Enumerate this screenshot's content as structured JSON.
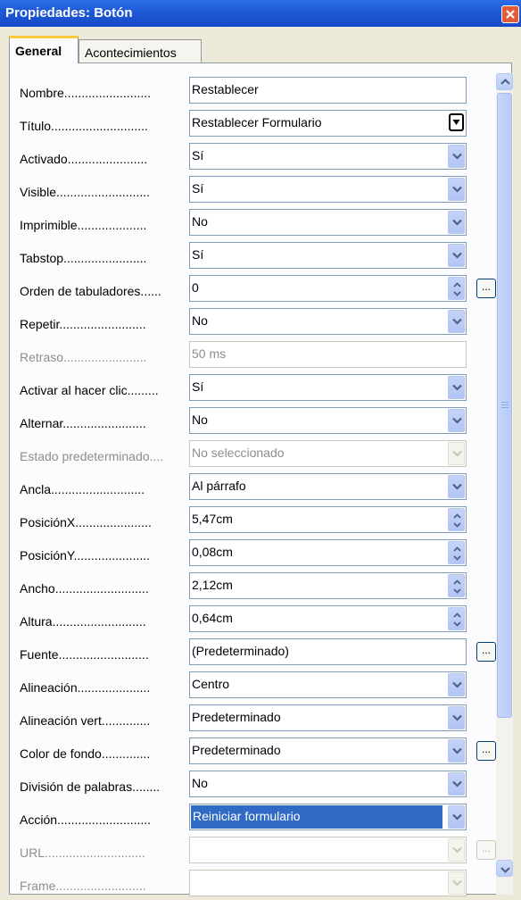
{
  "window": {
    "title": "Propiedades: Botón"
  },
  "tabs": [
    {
      "label": "General",
      "active": true
    },
    {
      "label": "Acontecimientos",
      "active": false
    }
  ],
  "properties": [
    {
      "label": "Nombre.........................",
      "value": "Restablecer",
      "control": "text",
      "disabled": false
    },
    {
      "label": "Título............................",
      "value": "Restablecer Formulario",
      "control": "combo-plain",
      "disabled": false
    },
    {
      "label": "Activado.......................",
      "value": "Sí",
      "control": "dropdown",
      "disabled": false
    },
    {
      "label": "Visible...........................",
      "value": "Sí",
      "control": "dropdown",
      "disabled": false
    },
    {
      "label": "Imprimible....................",
      "value": "No",
      "control": "dropdown",
      "disabled": false
    },
    {
      "label": "Tabstop........................",
      "value": "Sí",
      "control": "dropdown",
      "disabled": false
    },
    {
      "label": "Orden de tabuladores......",
      "value": "0",
      "control": "spin",
      "disabled": false,
      "has_dots": true
    },
    {
      "label": "Repetir.........................",
      "value": "No",
      "control": "dropdown",
      "disabled": false
    },
    {
      "label": "Retraso........................",
      "value": "50 ms",
      "control": "text",
      "disabled": true
    },
    {
      "label": "Activar al hacer clic.........",
      "value": "Sí",
      "control": "dropdown",
      "disabled": false
    },
    {
      "label": "Alternar........................",
      "value": "No",
      "control": "dropdown",
      "disabled": false
    },
    {
      "label": "Estado predeterminado....",
      "value": "No seleccionado",
      "control": "dropdown",
      "disabled": true
    },
    {
      "label": "Ancla...........................",
      "value": "Al párrafo",
      "control": "dropdown",
      "disabled": false
    },
    {
      "label": "PosiciónX......................",
      "value": "5,47cm",
      "control": "spin",
      "disabled": false
    },
    {
      "label": "PosiciónY......................",
      "value": "0,08cm",
      "control": "spin",
      "disabled": false
    },
    {
      "label": "Ancho...........................",
      "value": "2,12cm",
      "control": "spin",
      "disabled": false
    },
    {
      "label": "Altura...........................",
      "value": "0,64cm",
      "control": "spin",
      "disabled": false
    },
    {
      "label": "Fuente..........................",
      "value": "(Predeterminado)",
      "control": "text",
      "disabled": false,
      "has_dots": true
    },
    {
      "label": "Alineación.....................",
      "value": "Centro",
      "control": "dropdown",
      "disabled": false
    },
    {
      "label": "Alineación vert..............",
      "value": "Predeterminado",
      "control": "dropdown",
      "disabled": false
    },
    {
      "label": "Color de fondo..............",
      "value": "Predeterminado",
      "control": "dropdown",
      "disabled": false,
      "has_dots": true
    },
    {
      "label": "División de palabras........",
      "value": "No",
      "control": "dropdown",
      "disabled": false
    },
    {
      "label": "Acción...........................",
      "value": "Reiniciar formulario",
      "control": "dropdown",
      "disabled": false,
      "selected": true
    },
    {
      "label": "URL.............................",
      "value": "",
      "control": "dropdown",
      "disabled": true,
      "has_dots": true
    },
    {
      "label": "Frame..........................",
      "value": "",
      "control": "dropdown",
      "disabled": true
    }
  ],
  "dots_label": "...",
  "icons": {
    "close": "close-icon",
    "dropdown": "chevron-down-icon",
    "spin": "spin-arrows-icon",
    "scroll_up": "arrow-up-icon",
    "scroll_down": "arrow-down-icon"
  },
  "colors": {
    "titlebar": "#1f5ad6",
    "selection": "#316ac5",
    "disabled_text": "#8d8d8d"
  }
}
